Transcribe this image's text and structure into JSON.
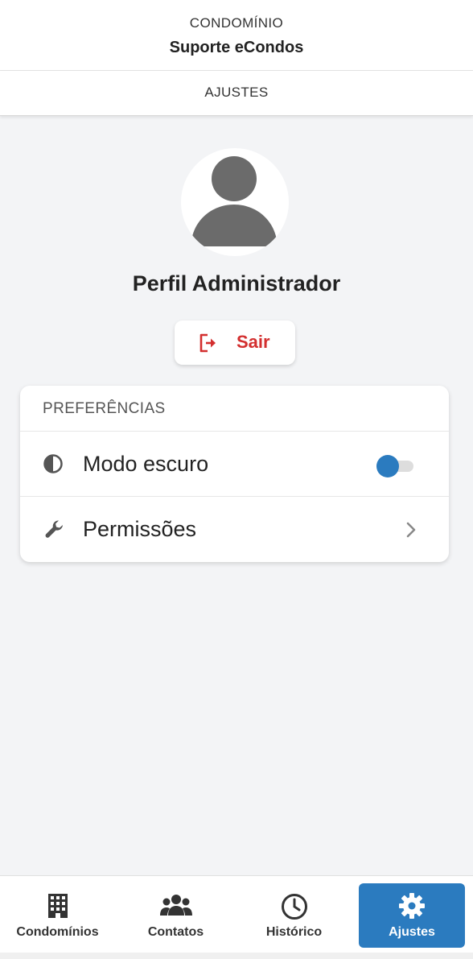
{
  "header": {
    "kicker": "CONDOMÍNIO",
    "title": "Suporte eCondos",
    "section": "AJUSTES"
  },
  "profile": {
    "avatar_icon": "person-icon",
    "name": "Perfil Administrador",
    "logout_label": "Sair",
    "logout_icon": "logout-icon"
  },
  "preferences": {
    "title": "PREFERÊNCIAS",
    "dark_mode": {
      "label": "Modo escuro",
      "icon": "contrast-icon",
      "enabled": false
    },
    "permissions": {
      "label": "Permissões",
      "icon": "wrench-icon"
    }
  },
  "bottom_nav": {
    "items": [
      {
        "label": "Condomínios",
        "icon": "building-icon",
        "active": false
      },
      {
        "label": "Contatos",
        "icon": "people-icon",
        "active": false
      },
      {
        "label": "Histórico",
        "icon": "clock-icon",
        "active": false
      },
      {
        "label": "Ajustes",
        "icon": "gear-icon",
        "active": true
      }
    ]
  },
  "colors": {
    "accent": "#2b7bbf",
    "danger": "#d32f2f",
    "background": "#f3f4f6"
  }
}
